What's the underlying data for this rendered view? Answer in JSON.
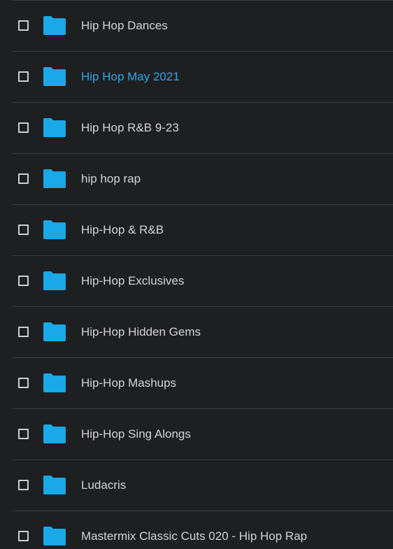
{
  "colors": {
    "background": "#1e1f21",
    "divider": "#3b3d40",
    "text": "#d4d4d4",
    "highlight": "#2aa9ea",
    "folder": "#1aa8e8"
  },
  "folders": [
    {
      "name": "Hip Hop Dances",
      "icon": "folder-icon",
      "highlighted": false
    },
    {
      "name": "Hip Hop May 2021",
      "icon": "folder-icon",
      "highlighted": true
    },
    {
      "name": "Hip Hop R&B 9-23",
      "icon": "folder-icon",
      "highlighted": false
    },
    {
      "name": "hip hop rap",
      "icon": "folder-icon",
      "highlighted": false
    },
    {
      "name": "Hip-Hop & R&B",
      "icon": "folder-icon",
      "highlighted": false
    },
    {
      "name": "Hip-Hop Exclusives",
      "icon": "folder-icon",
      "highlighted": false
    },
    {
      "name": "Hip-Hop Hidden Gems",
      "icon": "folder-icon",
      "highlighted": false
    },
    {
      "name": "Hip-Hop Mashups",
      "icon": "folder-icon",
      "highlighted": false
    },
    {
      "name": "Hip-Hop Sing Alongs",
      "icon": "folder-icon",
      "highlighted": false
    },
    {
      "name": "Ludacris",
      "icon": "folder-icon",
      "highlighted": false
    },
    {
      "name": "Mastermix Classic Cuts 020 - Hip Hop Rap",
      "icon": "folder-icon",
      "highlighted": false
    }
  ]
}
